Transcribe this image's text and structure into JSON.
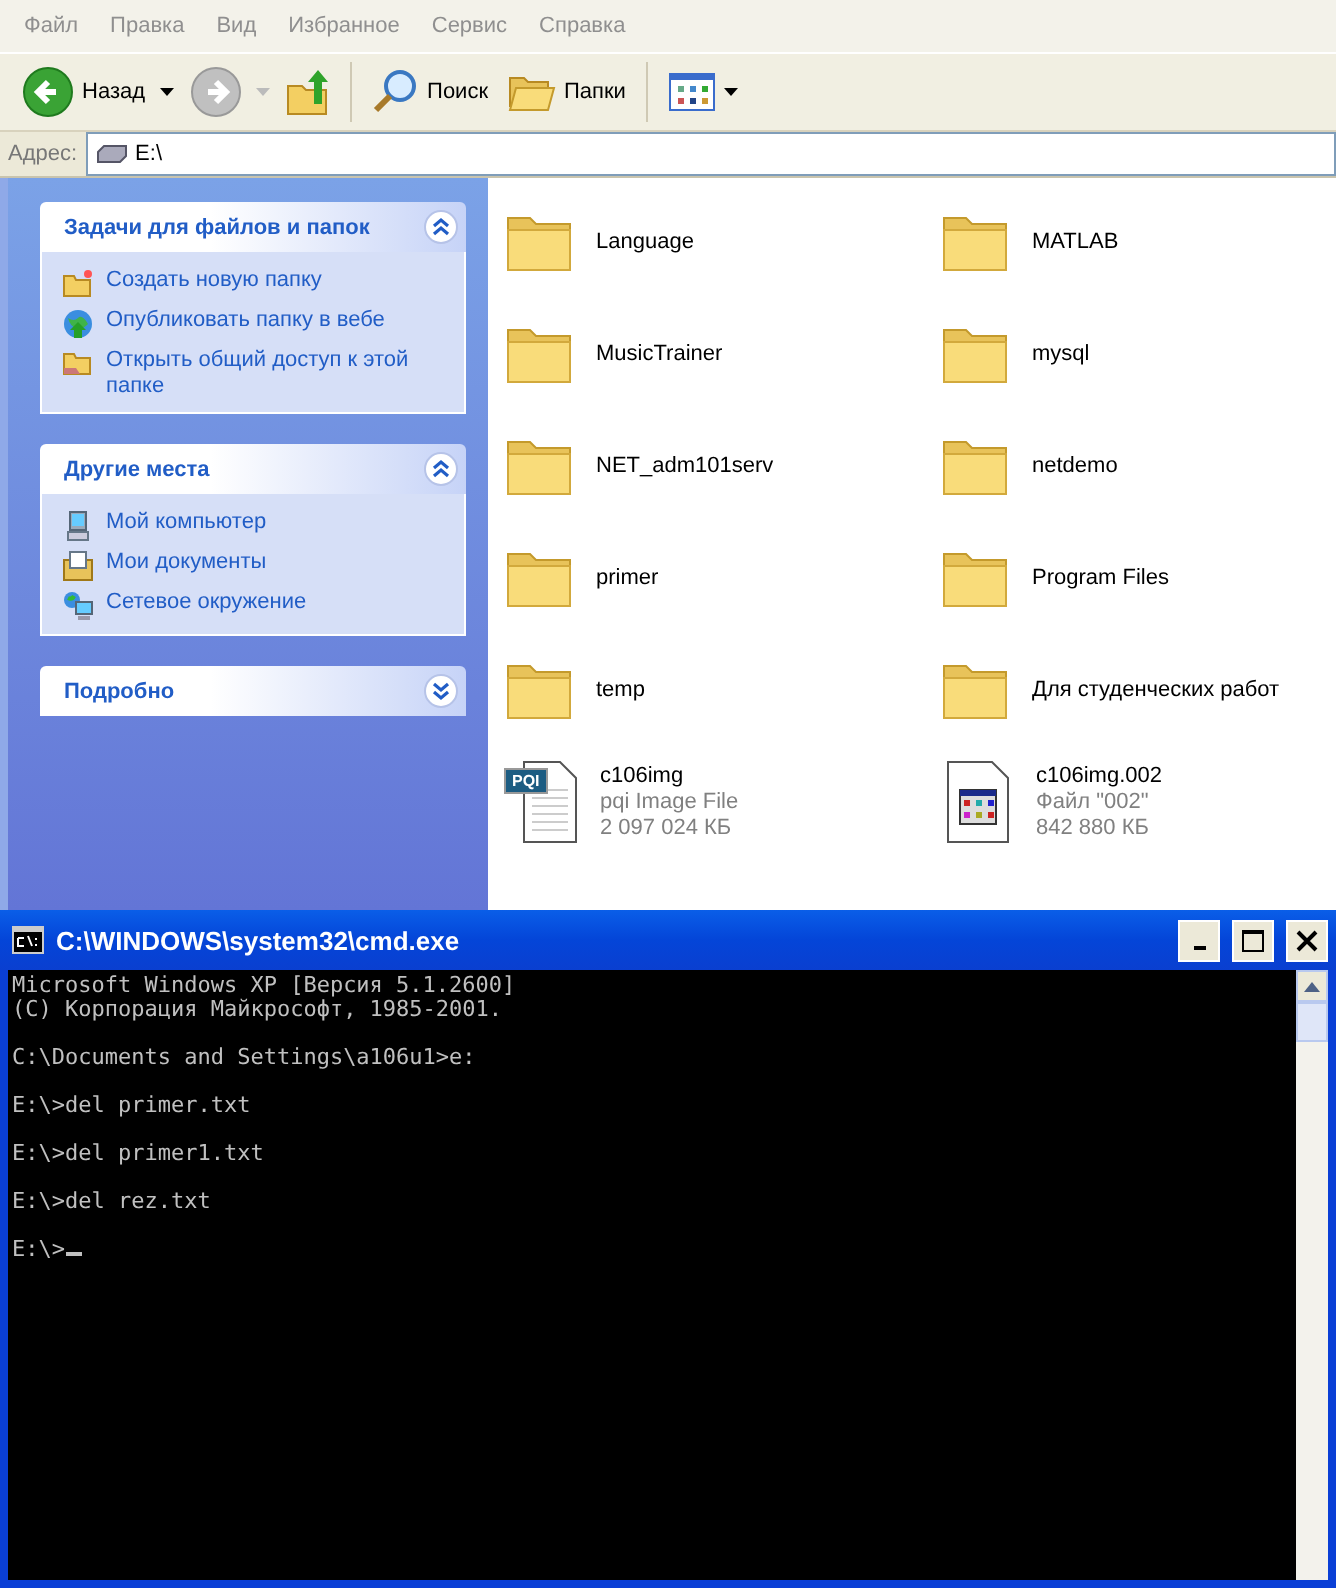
{
  "menu": [
    "Файл",
    "Правка",
    "Вид",
    "Избранное",
    "Сервис",
    "Справка"
  ],
  "toolbar": {
    "back": {
      "label": "Назад",
      "disabled": false
    },
    "forward": {
      "disabled": true
    },
    "search": {
      "label": "Поиск"
    },
    "folders": {
      "label": "Папки"
    }
  },
  "address": {
    "label": "Адрес:",
    "value": "E:\\"
  },
  "sidebar": [
    {
      "title": "Задачи для файлов и папок",
      "expanded": true,
      "items": [
        {
          "label": "Создать новую папку"
        },
        {
          "label": "Опубликовать папку в вебе"
        },
        {
          "label": "Открыть общий доступ к этой папке"
        }
      ]
    },
    {
      "title": "Другие места",
      "expanded": true,
      "items": [
        {
          "label": "Мой компьютер"
        },
        {
          "label": "Мои документы"
        },
        {
          "label": "Сетевое окружение"
        }
      ]
    },
    {
      "title": "Подробно",
      "expanded": false
    }
  ],
  "files": [
    {
      "kind": "folder",
      "name": "Language"
    },
    {
      "kind": "folder",
      "name": "MATLAB"
    },
    {
      "kind": "folder",
      "name": "MusicTrainer"
    },
    {
      "kind": "folder",
      "name": "mysql"
    },
    {
      "kind": "folder",
      "name": "NET_adm101serv"
    },
    {
      "kind": "folder",
      "name": "netdemo"
    },
    {
      "kind": "folder",
      "name": "primer"
    },
    {
      "kind": "folder",
      "name": "Program Files"
    },
    {
      "kind": "folder",
      "name": "temp"
    },
    {
      "kind": "folder",
      "name": "Для студенческих работ"
    },
    {
      "kind": "pqi",
      "name": "c106img",
      "badge": "PQI",
      "type": "pqi Image File",
      "size": "2 097 024 КБ"
    },
    {
      "kind": "app",
      "name": "c106img.002",
      "type": "Файл \"002\"",
      "size": "842 880 КБ"
    }
  ],
  "console": {
    "title": "C:\\WINDOWS\\system32\\cmd.exe",
    "cursor": true,
    "blocks": [
      [
        "Microsoft Windows XP [Версия 5.1.2600]",
        "(C) Корпорация Майкрософт, 1985-2001."
      ],
      [
        "C:\\Documents and Settings\\a106u1>e:"
      ],
      [
        "E:\\>del primer.txt"
      ],
      [
        "E:\\>del primer1.txt"
      ],
      [
        "E:\\>del rez.txt"
      ],
      [
        "E:\\>"
      ]
    ]
  }
}
